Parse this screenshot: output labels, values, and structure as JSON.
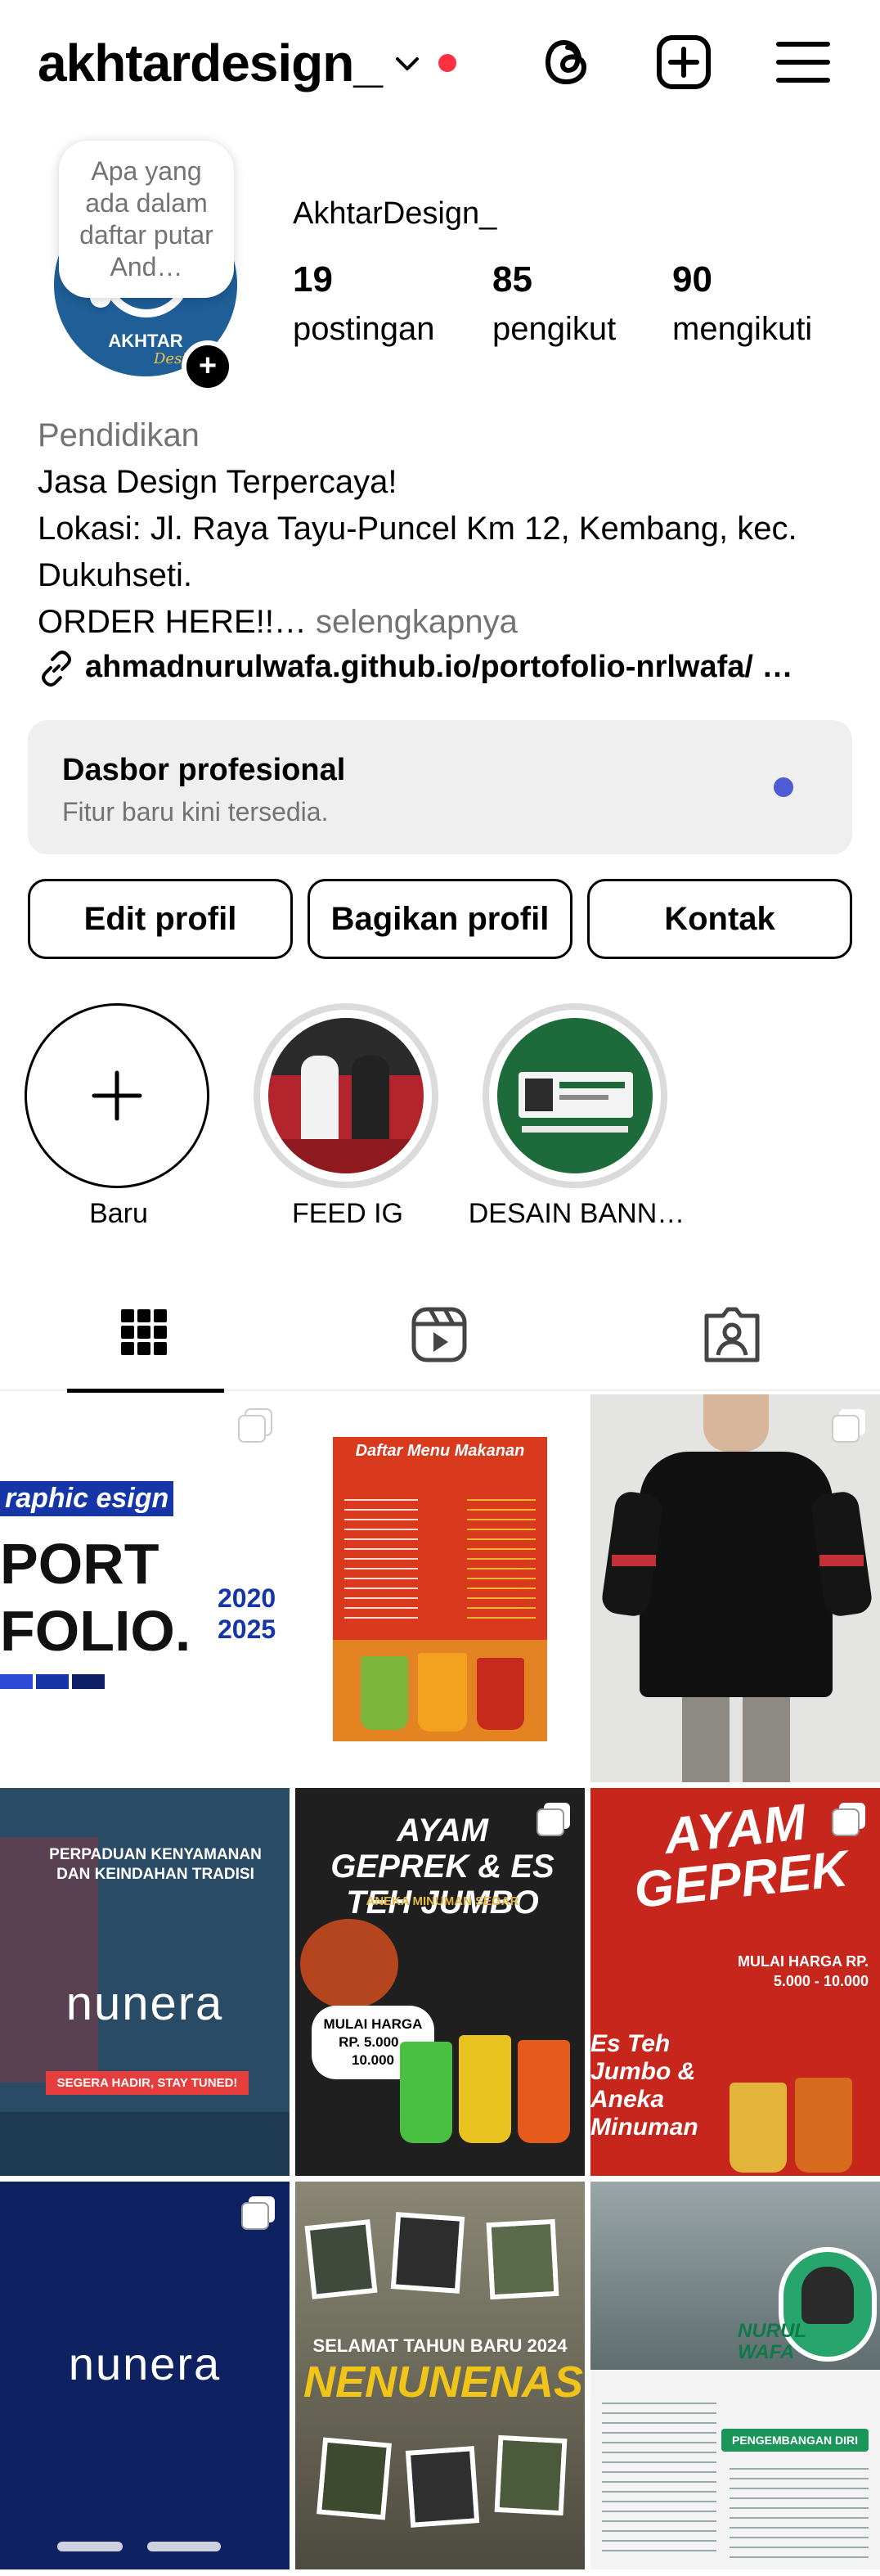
{
  "header": {
    "username": "akhtardesign_",
    "icons": [
      "chevron-down-icon",
      "threads-icon",
      "add-post-icon",
      "menu-icon"
    ],
    "notification_dot_color": "#ff3040"
  },
  "profile": {
    "note": "Apa yang ada dalam daftar putar And…",
    "avatar_text": "AKHTAR",
    "avatar_sub": "Design",
    "display_name": "AkhtarDesign_",
    "stats": {
      "posts": {
        "value": "19",
        "label": "postingan"
      },
      "followers": {
        "value": "85",
        "label": "pengikut"
      },
      "following": {
        "value": "90",
        "label": "mengikuti"
      }
    }
  },
  "bio": {
    "category": "Pendidikan",
    "line1": "Jasa Design Terpercaya!",
    "line2": "Lokasi: Jl. Raya Tayu-Puncel Km 12, Kembang, kec. Dukuhseti.",
    "line3_start": "ORDER HERE!!…",
    "more": " selengkapnya",
    "link": "ahmadnurulwafa.github.io/portofolio-nrlwafa/ …"
  },
  "dashboard": {
    "title": "Dasbor profesional",
    "subtitle": "Fitur baru kini tersedia.",
    "dot_color": "#4f5bd5"
  },
  "buttons": {
    "edit": "Edit profil",
    "share": "Bagikan profil",
    "contact": "Kontak"
  },
  "highlights": [
    {
      "label": "Baru"
    },
    {
      "label": "FEED IG"
    },
    {
      "label": "DESAIN BANN…"
    }
  ],
  "tabs": [
    "grid-icon",
    "reels-icon",
    "tagged-icon"
  ],
  "posts": [
    {
      "title": "raphic esign",
      "big": "PORT FOLIO.",
      "years": "2020 2025"
    },
    {
      "title": "Daftar Menu Makanan"
    },
    {
      "title": ""
    },
    {
      "title": "PERPADUAN KENYAMANAN DAN KEINDAHAN TRADISI",
      "brand": "nunera",
      "tagline": "SEGERA HADIR, STAY TUNED!"
    },
    {
      "title": "AYAM GEPREK & ES TEH JUMBO",
      "sub": "ANEKA MINUMAN SEGAR",
      "price": "MULAI HARGA RP. 5.000 - 10.000"
    },
    {
      "title": "AYAM GEPREK",
      "price": "MULAI HARGA RP. 5.000 - 10.000",
      "sub": "Es Teh Jumbo & Aneka Minuman"
    },
    {
      "brand": "nunera"
    },
    {
      "title": "SELAMAT TAHUN BARU 2024",
      "big": "NENUNENAS"
    },
    {
      "title": "NURUL WAFA",
      "sub": "PENGEMBANGAN DIRI"
    }
  ]
}
